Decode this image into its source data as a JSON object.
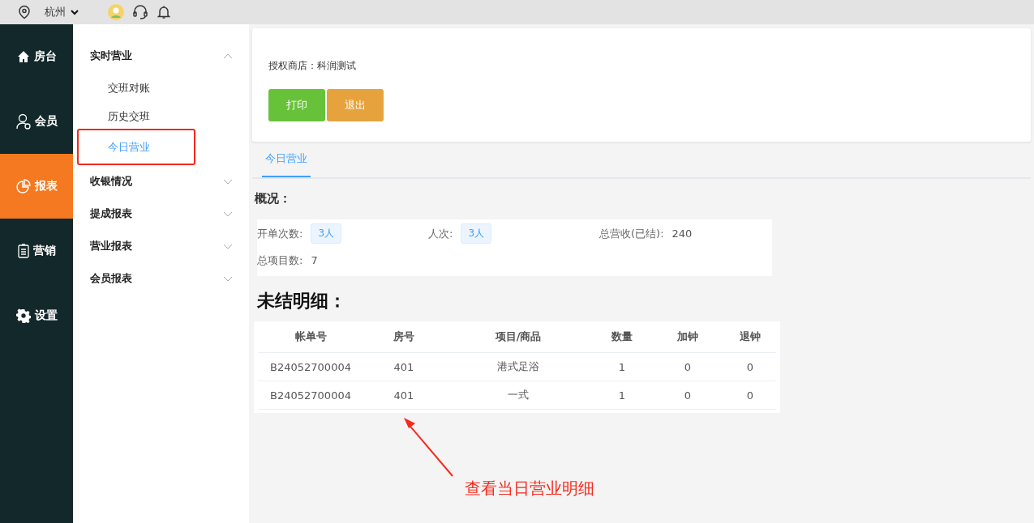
{
  "top_bar": {
    "city": "杭州"
  },
  "nav": [
    {
      "label": "房台",
      "kind": "home",
      "selected": false
    },
    {
      "label": "会员",
      "kind": "member",
      "selected": false
    },
    {
      "label": "报表",
      "kind": "chart",
      "selected": true
    },
    {
      "label": "营销",
      "kind": "clipboard",
      "selected": false
    },
    {
      "label": "设置",
      "kind": "gear",
      "selected": false
    }
  ],
  "submenu": [
    {
      "label": "实时营业",
      "expanded": true,
      "children": [
        {
          "label": "交班对账",
          "selected": false,
          "highlighted": false
        },
        {
          "label": "历史交班",
          "selected": false,
          "highlighted": false
        },
        {
          "label": "今日营业",
          "selected": true,
          "highlighted": true
        }
      ]
    },
    {
      "label": "收银情况",
      "expanded": false
    },
    {
      "label": "提成报表",
      "expanded": false
    },
    {
      "label": "营业报表",
      "expanded": false
    },
    {
      "label": "会员报表",
      "expanded": false
    }
  ],
  "store_label": "授权商店：科润测试",
  "buttons": [
    {
      "label": "打印",
      "kind": "print"
    },
    {
      "label": "退出",
      "kind": "exit"
    }
  ],
  "tabs": [
    {
      "label": "今日营业",
      "selected": true
    }
  ],
  "overview": {
    "title": "概况：",
    "fields": [
      {
        "label": "开单次数:",
        "value": "3人",
        "kind": "tag"
      },
      {
        "label": "人次:",
        "value": "3人",
        "kind": "tag"
      },
      {
        "label": "总营收(已结):",
        "value": "240",
        "kind": "plain"
      },
      {
        "label": "总项目数:",
        "value": "7",
        "kind": "plain"
      }
    ]
  },
  "detail": {
    "title": "未结明细：",
    "columns": [
      "帐单号",
      "房号",
      "项目/商品",
      "数量",
      "加钟",
      "退钟"
    ],
    "rows": [
      [
        "B24052700004",
        "401",
        "港式足浴",
        "1",
        "0",
        "0"
      ],
      [
        "B24052700004",
        "401",
        "一式",
        "1",
        "0",
        "0"
      ]
    ]
  },
  "annotation": {
    "text": "查看当日营业明细"
  }
}
